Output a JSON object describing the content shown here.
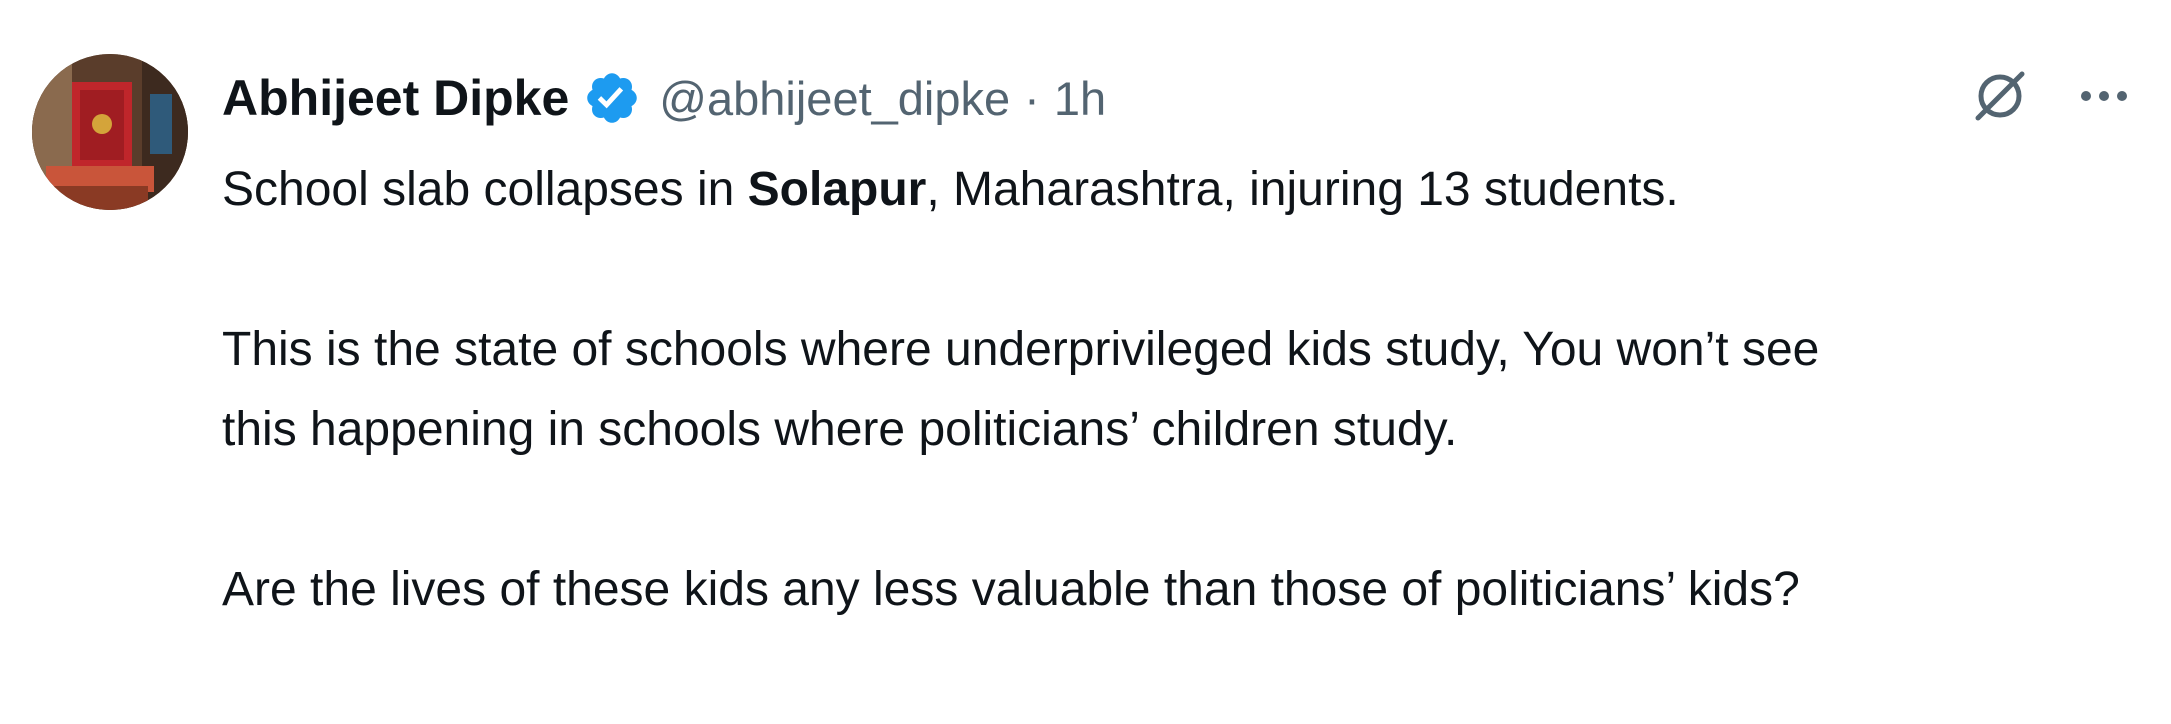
{
  "tweet": {
    "author": {
      "display_name": "Abhijeet Dipke",
      "handle": "@abhijeet_dipke",
      "verified": true,
      "avatar_icon": "avatar-photo"
    },
    "separator": "·",
    "time": "1h",
    "actions": {
      "grok_icon": "grok-icon",
      "more_icon": "more-options-icon"
    },
    "text": {
      "line1_before": "School slab collapses in ",
      "line1_bold": "Solapur",
      "line1_after": ", Maharashtra, injuring 13 students.",
      "para2_line1": "This is the state of schools where underprivileged kids study, You won’t see",
      "para2_line2": "this happening in schools where politicians’ children study.",
      "para3": "Are the lives of these kids any less valuable than those of politicians’ kids?"
    },
    "colors": {
      "text": "#0f1419",
      "secondary": "#536471",
      "verified_badge": "#1d9bf0"
    }
  }
}
